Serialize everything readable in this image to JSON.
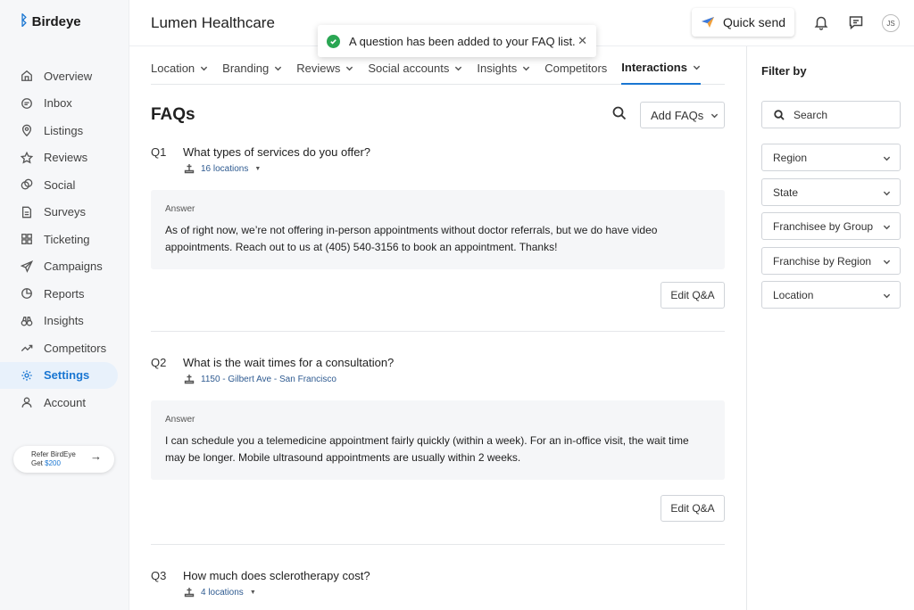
{
  "brand": {
    "name": "Birdeye"
  },
  "sidebar": {
    "items": [
      {
        "label": "Overview",
        "icon": "home-icon"
      },
      {
        "label": "Inbox",
        "icon": "chat-icon"
      },
      {
        "label": "Listings",
        "icon": "pin-icon"
      },
      {
        "label": "Reviews",
        "icon": "star-icon"
      },
      {
        "label": "Social",
        "icon": "social-icon"
      },
      {
        "label": "Surveys",
        "icon": "survey-icon"
      },
      {
        "label": "Ticketing",
        "icon": "grid-icon"
      },
      {
        "label": "Campaigns",
        "icon": "send-icon"
      },
      {
        "label": "Reports",
        "icon": "pie-icon"
      },
      {
        "label": "Insights",
        "icon": "binoculars-icon"
      },
      {
        "label": "Competitors",
        "icon": "trend-icon"
      },
      {
        "label": "Settings",
        "icon": "gear-icon",
        "active": true
      },
      {
        "label": "Account",
        "icon": "user-icon"
      }
    ],
    "refer": {
      "line1": "Refer BirdEye",
      "line2_prefix": "Get ",
      "amount": "$200"
    }
  },
  "header": {
    "company": "Lumen Healthcare",
    "quick_send": "Quick send",
    "avatar_initials": "JS"
  },
  "toast": {
    "message": "A question has been added to your FAQ list."
  },
  "subnav": {
    "items": [
      {
        "label": "Location",
        "dropdown": true
      },
      {
        "label": "Branding",
        "dropdown": true
      },
      {
        "label": "Reviews",
        "dropdown": true
      },
      {
        "label": "Social accounts",
        "dropdown": true
      },
      {
        "label": "Insights",
        "dropdown": true
      },
      {
        "label": "Competitors",
        "dropdown": false
      },
      {
        "label": "Interactions",
        "dropdown": true,
        "active": true
      }
    ]
  },
  "main": {
    "title": "FAQs",
    "add_button": "Add FAQs",
    "answer_label": "Answer",
    "edit_label": "Edit Q&A",
    "faqs": [
      {
        "num": "Q1",
        "question": "What types of services do you offer?",
        "location": "16 locations",
        "answer": "As of right now, we’re not offering in-person appointments without doctor referrals, but we do have video appointments. Reach out to us at (405) 540-3156 to book an appointment. Thanks!"
      },
      {
        "num": "Q2",
        "question": "What is the wait times for a consultation?",
        "location": "1150 - Gilbert Ave - San Francisco",
        "answer": "I can schedule you a telemedicine appointment fairly quickly (within a week). For an in-office visit, the wait time may be longer. Mobile ultrasound appointments are usually within 2 weeks."
      },
      {
        "num": "Q3",
        "question": "How much does sclerotherapy cost?",
        "location": "4 locations"
      }
    ]
  },
  "filters": {
    "title": "Filter by",
    "search_placeholder": "Search",
    "selects": [
      "Region",
      "State",
      "Franchisee by Group",
      "Franchise by Region",
      "Location"
    ]
  },
  "colors": {
    "accent": "#1976d2",
    "success": "#2aa653",
    "link": "#2f5b91"
  }
}
